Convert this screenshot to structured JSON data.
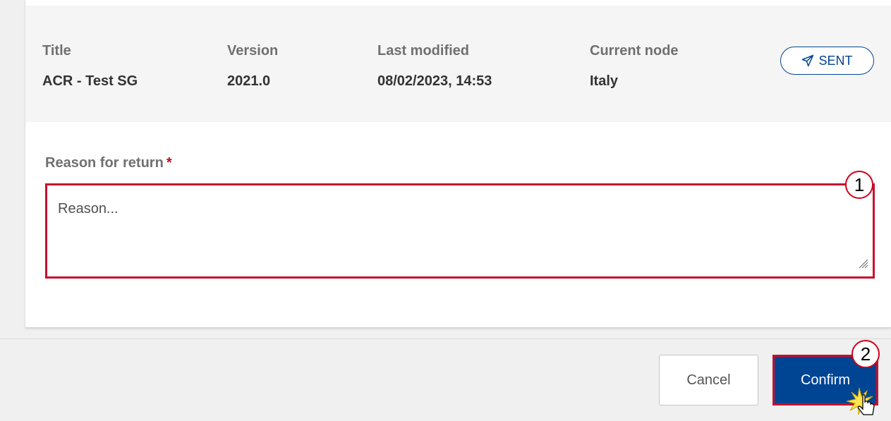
{
  "document": {
    "fields": [
      {
        "label": "Title",
        "value": "ACR - Test SG"
      },
      {
        "label": "Version",
        "value": "2021.0"
      },
      {
        "label": "Last modified",
        "value": "08/02/2023, 14:53"
      },
      {
        "label": "Current node",
        "value": "Italy"
      }
    ],
    "status": {
      "label": "SENT",
      "icon": "paper-plane-icon",
      "color": "#004494"
    }
  },
  "form": {
    "reason_label": "Reason for return",
    "required_marker": "*",
    "reason_placeholder": "Reason..."
  },
  "callouts": [
    "1",
    "2"
  ],
  "actions": {
    "cancel_label": "Cancel",
    "confirm_label": "Confirm"
  },
  "colors": {
    "primary": "#004494",
    "highlight": "#c8102e",
    "header_bg": "#f5f5f5"
  }
}
